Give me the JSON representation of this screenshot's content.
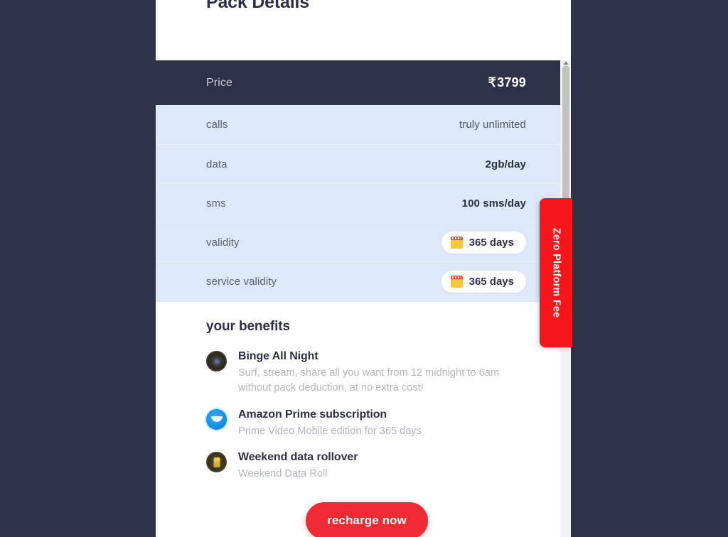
{
  "page": {
    "title": "Pack Details",
    "background_color": "#2e3248",
    "card_background": "#ffffff"
  },
  "price_row": {
    "label": "Price",
    "currency_symbol": "₹",
    "amount": "3799",
    "background_color": "#2e3248"
  },
  "details": {
    "background_color": "#dde8f9",
    "rows": [
      {
        "key": "calls",
        "value": "truly unlimited",
        "style": "light",
        "has_pill": false
      },
      {
        "key": "data",
        "value": "2gb/day",
        "style": "bold",
        "has_pill": false
      },
      {
        "key": "sms",
        "value": "100 sms/day",
        "style": "bold",
        "has_pill": false
      },
      {
        "key": "validity",
        "value": "365 days",
        "style": "pill",
        "has_pill": true,
        "icon": "calendar-icon"
      },
      {
        "key": "service validity",
        "value": "365 days",
        "style": "pill",
        "has_pill": true,
        "icon": "calendar-icon"
      }
    ]
  },
  "benefits": {
    "heading": "your benefits",
    "items": [
      {
        "icon": "binge-all-night-icon",
        "title": "Binge All Night",
        "description": "Surf, stream, share all you want from 12 midnight to 6am without pack deduction, at no extra cost!"
      },
      {
        "icon": "amazon-prime-icon",
        "title": "Amazon Prime subscription",
        "description": "Prime Video Mobile edition for 365 days"
      },
      {
        "icon": "weekend-rollover-icon",
        "title": "Weekend data rollover",
        "description": "Weekend Data Roll"
      }
    ]
  },
  "fee_tab": {
    "label": "Zero Platform Fee",
    "color": "#f5161c"
  },
  "cta": {
    "label": "recharge now",
    "color": "#ee2a35"
  }
}
